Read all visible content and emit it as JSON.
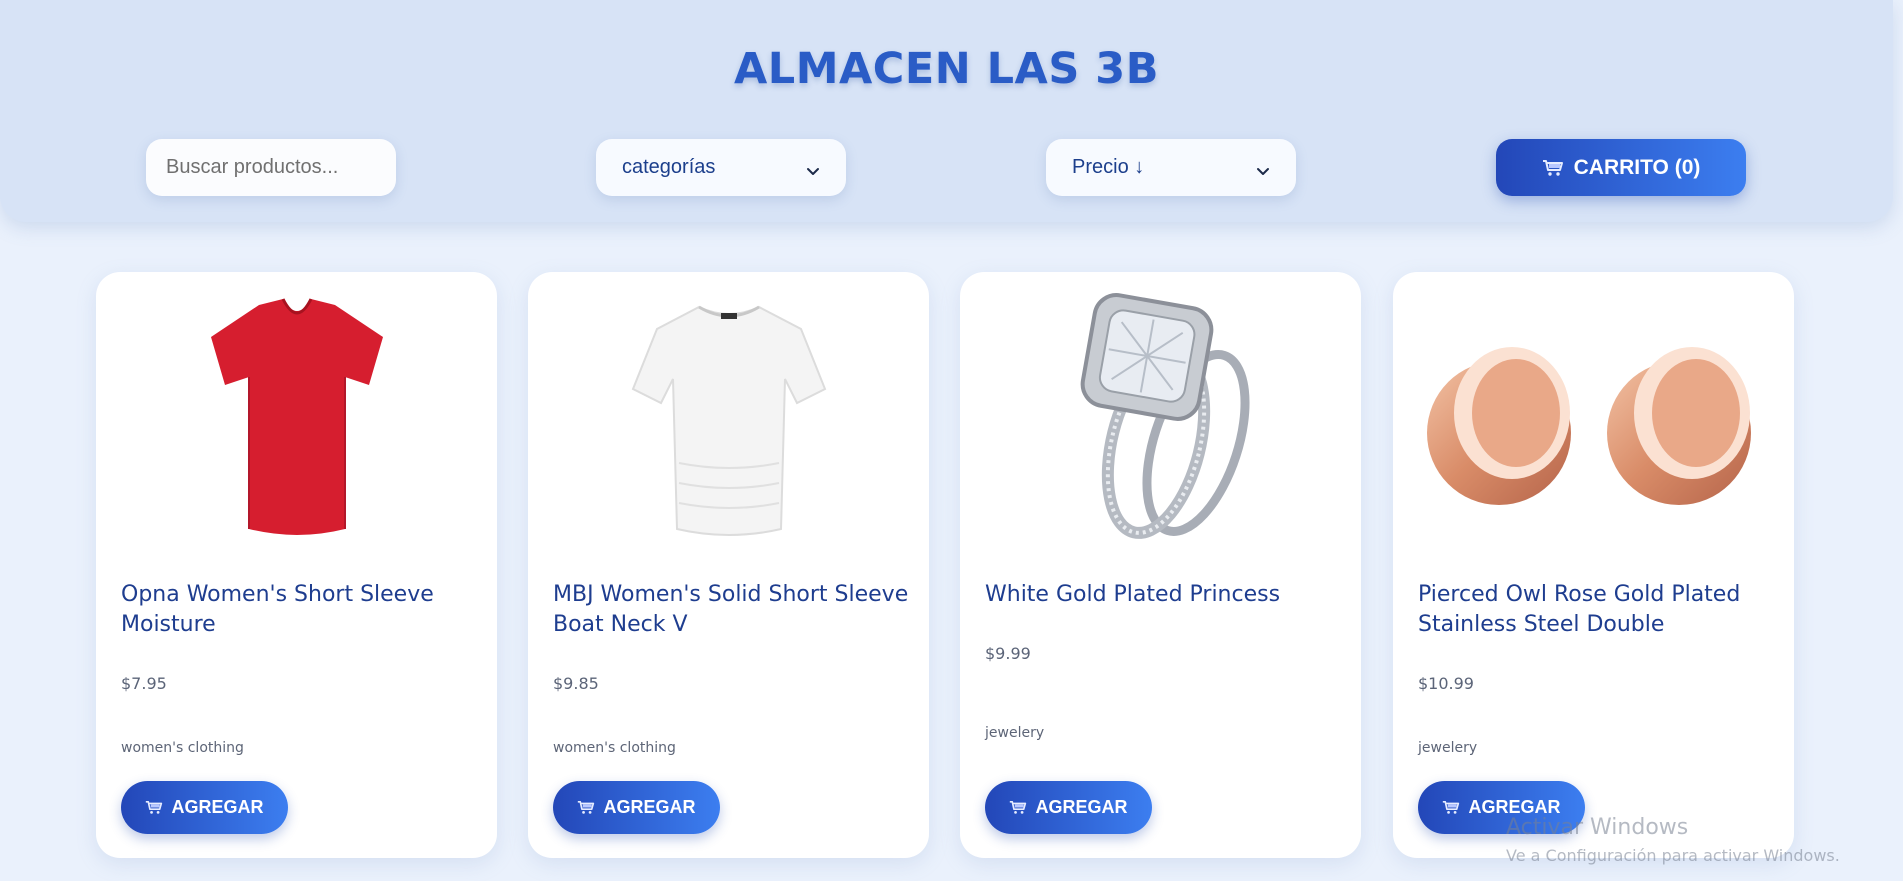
{
  "header": {
    "title": "ALMACEN LAS 3B",
    "search_placeholder": "Buscar productos...",
    "category_select": "categorías",
    "price_select": "Precio ↓",
    "cart_label": "CARRITO (0)"
  },
  "products": [
    {
      "name": "Opna Women's Short Sleeve Moisture",
      "price": "$7.95",
      "category": "women's clothing",
      "button": "AGREGAR",
      "image": "red-tshirt"
    },
    {
      "name": "MBJ Women's Solid Short Sleeve Boat Neck V",
      "price": "$9.85",
      "category": "women's clothing",
      "button": "AGREGAR",
      "image": "white-top"
    },
    {
      "name": "White Gold Plated Princess",
      "price": "$9.99",
      "category": "jewelery",
      "button": "AGREGAR",
      "image": "diamond-ring"
    },
    {
      "name": "Pierced Owl Rose Gold Plated Stainless Steel Double",
      "price": "$10.99",
      "category": "jewelery",
      "button": "AGREGAR",
      "image": "rose-gold-plugs"
    }
  ],
  "watermark": {
    "line1": "Activar Windows",
    "line2": "Ve a Configuración para activar Windows."
  },
  "colors": {
    "brand": "#2a5cc6",
    "button_start": "#2347b8",
    "button_end": "#3c7ef0",
    "header_bg": "#d7e3f6",
    "page_bg": "#eaf1fc"
  }
}
